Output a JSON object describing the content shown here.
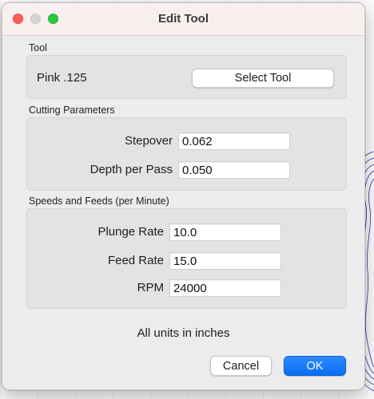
{
  "window": {
    "title": "Edit Tool"
  },
  "tool": {
    "section_label": "Tool",
    "name": "Pink .125",
    "select_button": "Select Tool"
  },
  "cutting": {
    "section_label": "Cutting Parameters",
    "stepover_label": "Stepover",
    "stepover_value": "0.062",
    "depth_label": "Depth per Pass",
    "depth_value": "0.050"
  },
  "speeds": {
    "section_label": "Speeds and Feeds (per Minute)",
    "plunge_label": "Plunge Rate",
    "plunge_value": "10.0",
    "feed_label": "Feed Rate",
    "feed_value": "15.0",
    "rpm_label": "RPM",
    "rpm_value": "24000"
  },
  "units_note": "All units in inches",
  "buttons": {
    "cancel": "Cancel",
    "ok": "OK"
  },
  "colors": {
    "accent": "#0a6cf2",
    "close": "#fd5f57",
    "maximize": "#2ac840",
    "contour": "#2b2bb8"
  }
}
